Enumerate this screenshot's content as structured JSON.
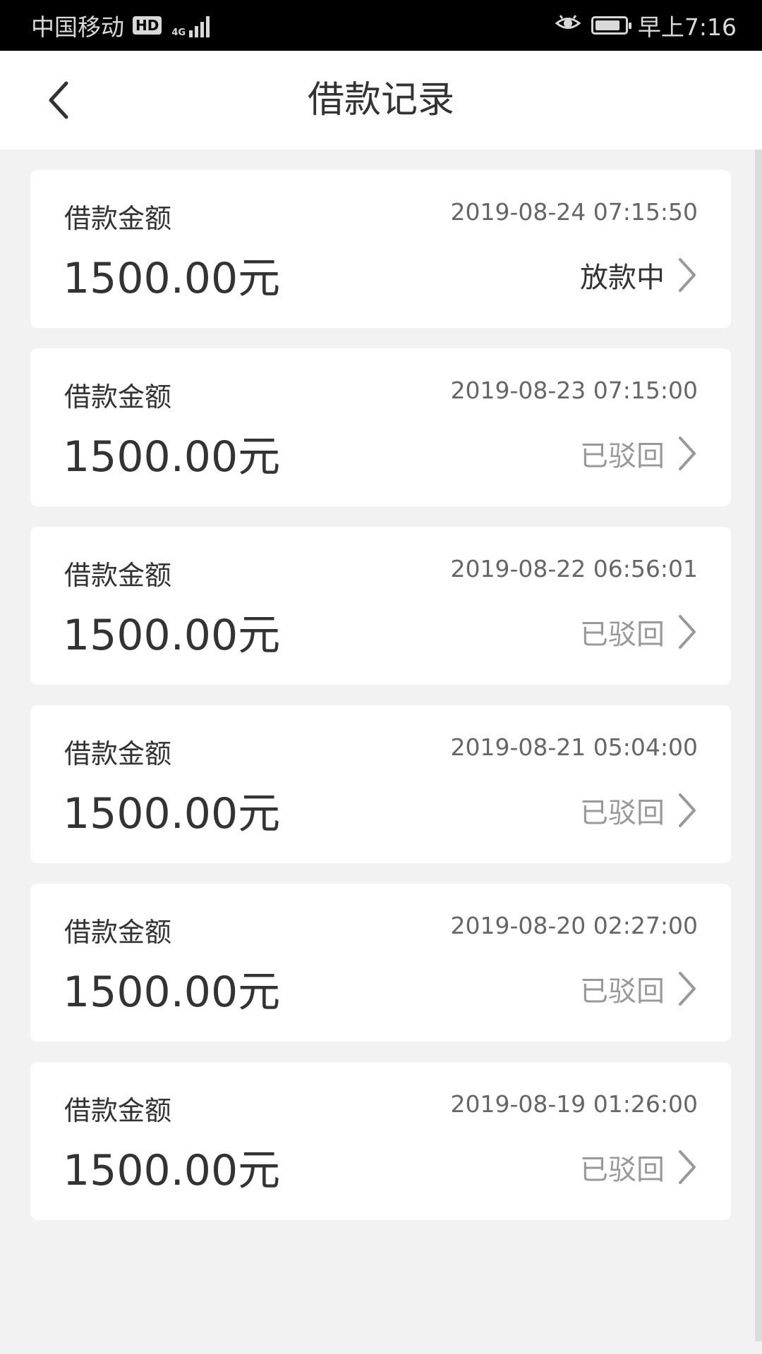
{
  "status_bar": {
    "carrier": "中国移动",
    "hd_badge": "HD",
    "network": "4G",
    "time": "早上7:16",
    "icons": [
      "hd-icon",
      "signal-icon",
      "eye-icon",
      "battery-icon"
    ],
    "battery_level": 0.85
  },
  "nav": {
    "title": "借款记录",
    "back_icon": "chevron-left-icon"
  },
  "records": [
    {
      "label": "借款金额",
      "amount": "1500.00元",
      "date": "2019-08-24 07:15:50",
      "status": "放款中",
      "active": true
    },
    {
      "label": "借款金额",
      "amount": "1500.00元",
      "date": "2019-08-23 07:15:00",
      "status": "已驳回",
      "active": false
    },
    {
      "label": "借款金额",
      "amount": "1500.00元",
      "date": "2019-08-22 06:56:01",
      "status": "已驳回",
      "active": false
    },
    {
      "label": "借款金额",
      "amount": "1500.00元",
      "date": "2019-08-21 05:04:00",
      "status": "已驳回",
      "active": false
    },
    {
      "label": "借款金额",
      "amount": "1500.00元",
      "date": "2019-08-20 02:27:00",
      "status": "已驳回",
      "active": false
    },
    {
      "label": "借款金额",
      "amount": "1500.00元",
      "date": "2019-08-19 01:26:00",
      "status": "已驳回",
      "active": false
    }
  ],
  "colors": {
    "background": "#f2f2f2",
    "card": "#ffffff",
    "text_primary": "#333333",
    "text_secondary": "#666666",
    "text_muted": "#999999"
  }
}
